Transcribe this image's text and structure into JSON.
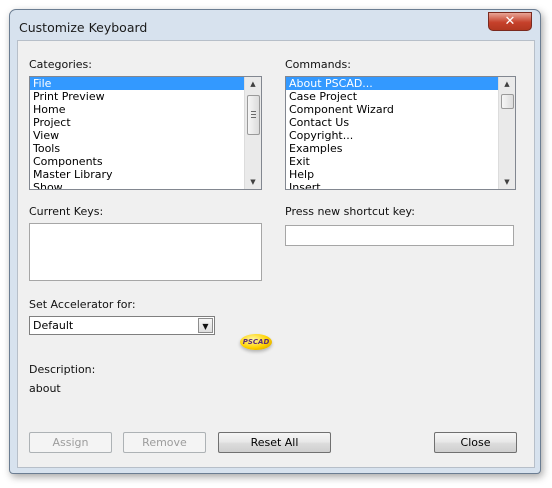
{
  "window": {
    "title": "Customize Keyboard",
    "close_glyph": "✕"
  },
  "categories": {
    "label": "Categories:",
    "items": [
      "File",
      "Print Preview",
      "Home",
      "Project",
      "View",
      "Tools",
      "Components",
      "Master Library",
      "Show"
    ],
    "selected": "File"
  },
  "commands": {
    "label": "Commands:",
    "items": [
      "About PSCAD...",
      "Case Project",
      "Component Wizard",
      "Contact Us",
      "Copyright...",
      "Examples",
      "Exit",
      "Help",
      "Insert"
    ],
    "selected": "About PSCAD..."
  },
  "current_keys": {
    "label": "Current Keys:"
  },
  "shortcut": {
    "label": "Press new shortcut key:",
    "value": ""
  },
  "accelerator": {
    "label": "Set Accelerator for:",
    "value": "Default"
  },
  "logo": {
    "text": "PSCAD"
  },
  "description": {
    "label": "Description:",
    "value": "about"
  },
  "buttons": {
    "assign": "Assign",
    "remove": "Remove",
    "reset_all": "Reset All",
    "close": "Close"
  },
  "colors": {
    "selection": "#3399ff",
    "title_bar": "#d7e2ee",
    "close_button": "#c6412b"
  }
}
